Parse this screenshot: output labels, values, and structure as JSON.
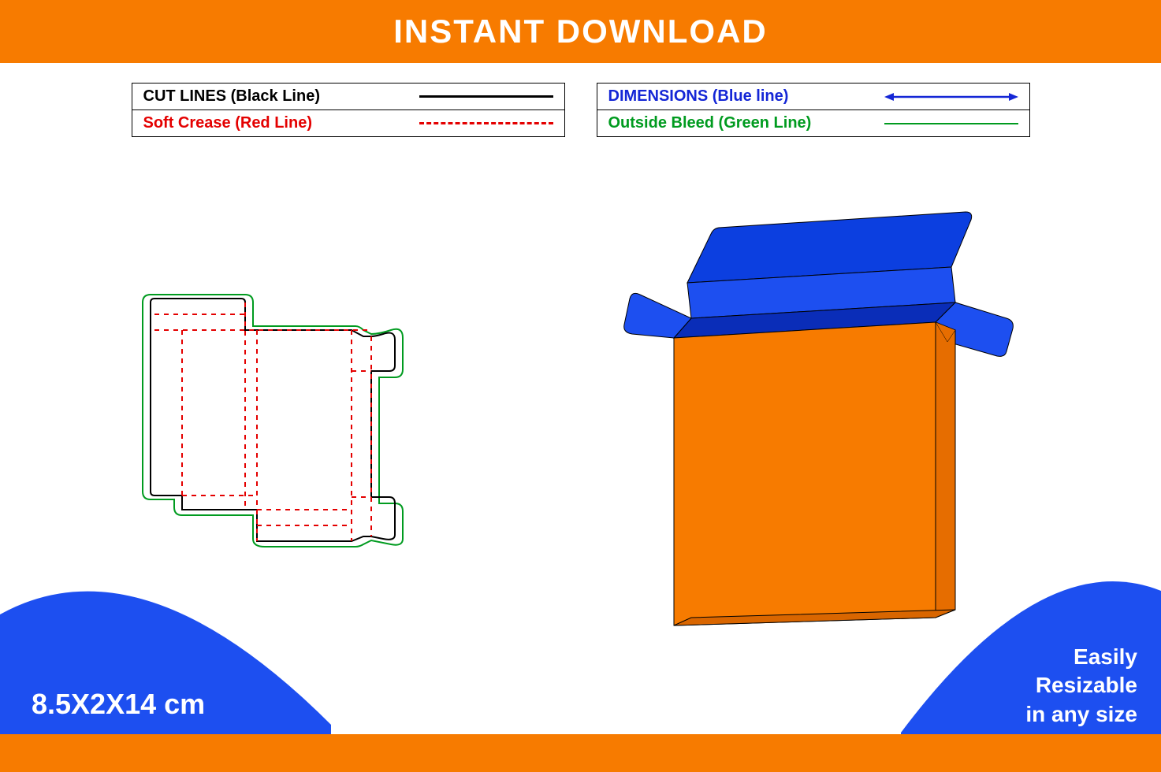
{
  "header": {
    "title": "INSTANT DOWNLOAD"
  },
  "legend": {
    "left": [
      {
        "label": "CUT LINES (Black Line)",
        "color": "#000000"
      },
      {
        "label": "Soft Crease (Red Line)",
        "color": "#e40000"
      }
    ],
    "right": [
      {
        "label": "DIMENSIONS (Blue line)",
        "color": "#1426d6"
      },
      {
        "label": "Outside Bleed (Green Line)",
        "color": "#009b1f"
      }
    ]
  },
  "dimensions": "8.5X2X14 cm",
  "resizable": {
    "line1": "Easily",
    "line2": "Resizable",
    "line3": "in any size"
  },
  "colors": {
    "orange": "#f77b00",
    "blue": "#1426d6",
    "box_blue": "#0c3fe0",
    "red": "#e40000",
    "green": "#009b1f",
    "black": "#000000"
  }
}
